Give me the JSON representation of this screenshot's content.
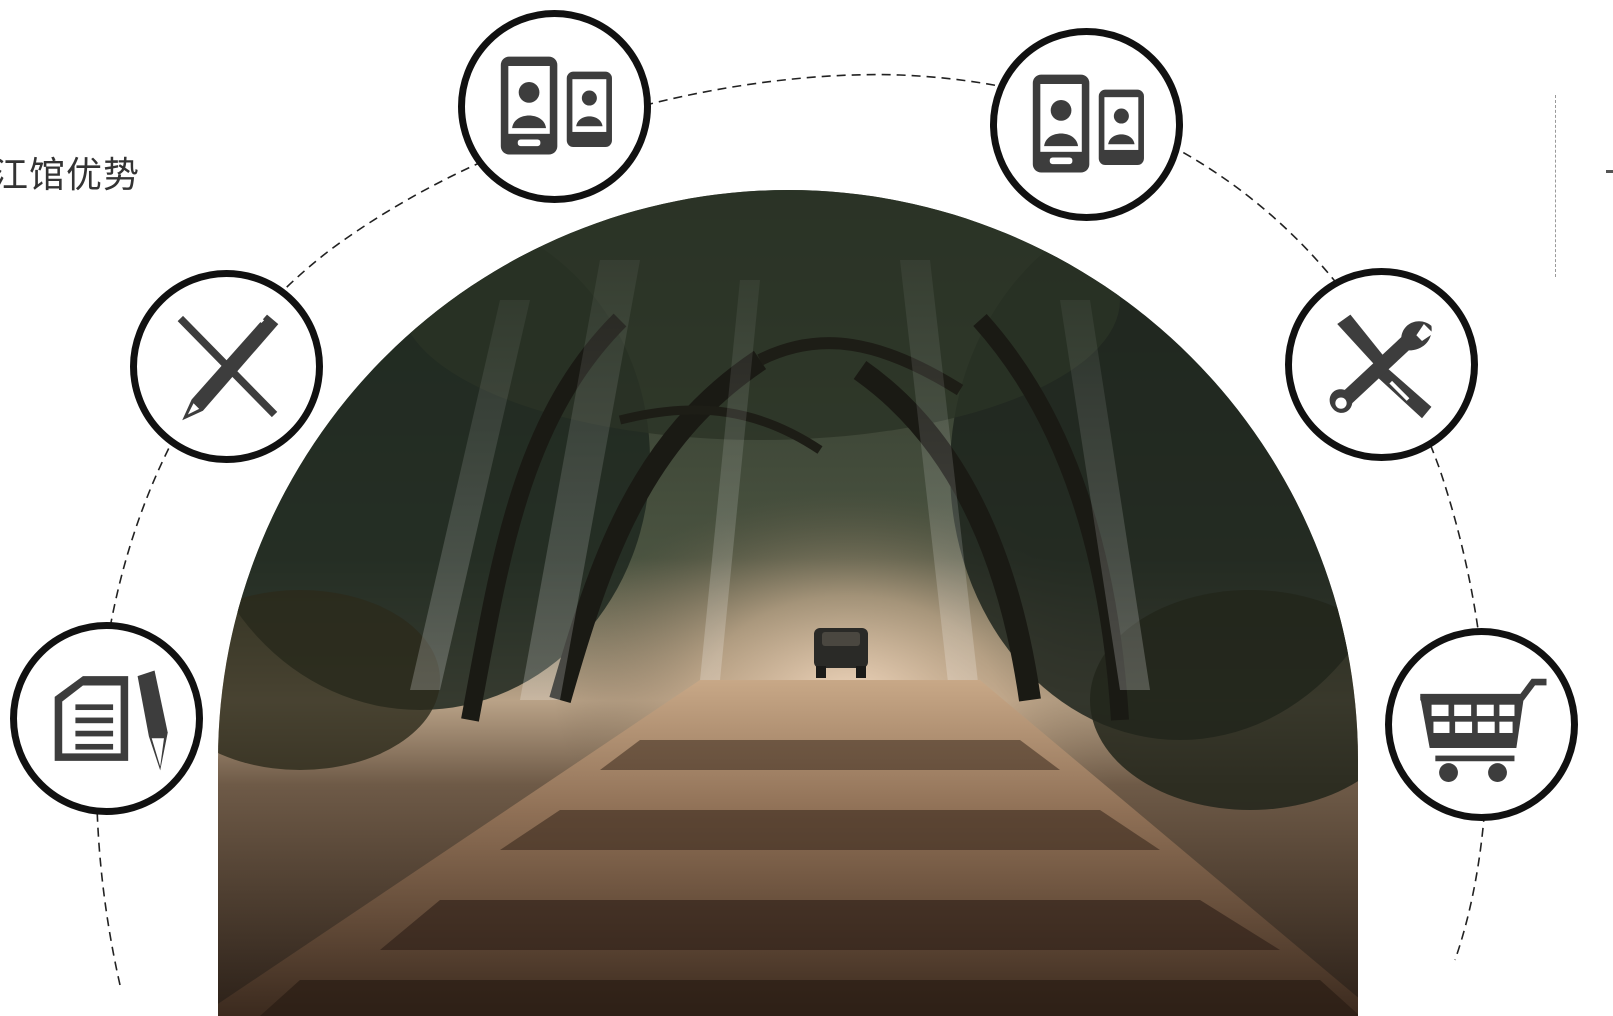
{
  "slide": {
    "title": "江馆优势"
  },
  "hero_image": {
    "subject": "tree-lined-road-with-car-photo"
  },
  "icons": [
    {
      "name": "contract-pen-icon"
    },
    {
      "name": "design-pen-ruler-icon"
    },
    {
      "name": "mobile-contacts-icon"
    },
    {
      "name": "mobile-contacts-icon"
    },
    {
      "name": "tools-wrench-screwdriver-icon"
    },
    {
      "name": "shopping-cart-icon"
    }
  ],
  "colors": {
    "ring": "#111111",
    "icon_fill": "#3d3d3d",
    "dashed_arc": "#222222",
    "title_text": "#333333"
  }
}
